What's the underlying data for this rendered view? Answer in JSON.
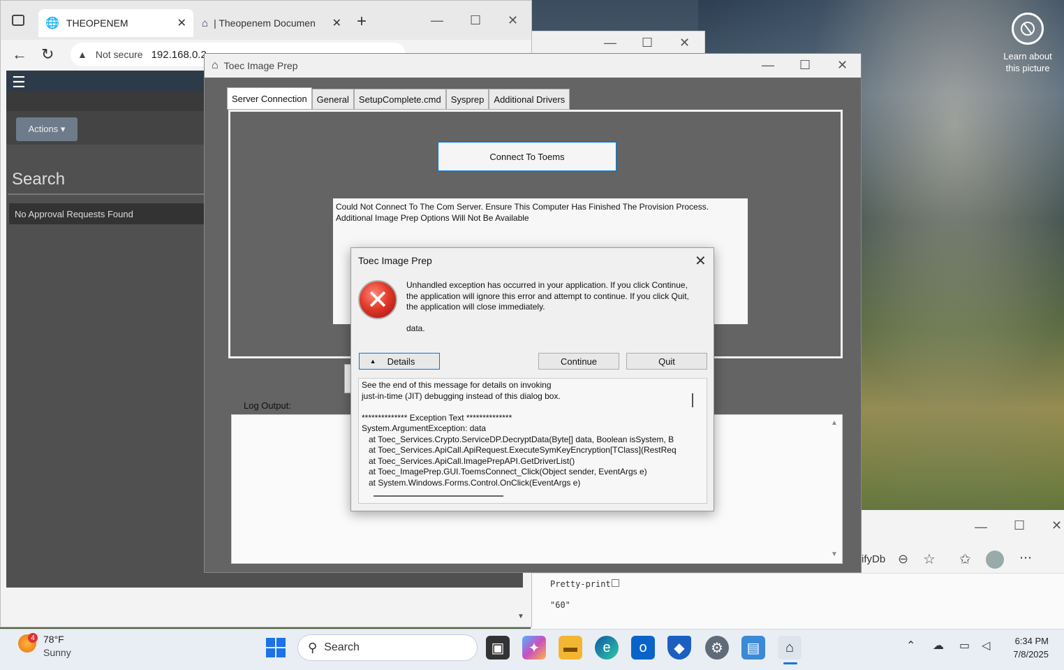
{
  "browser": {
    "tab1_label": "THEOPENEM",
    "tab2_label": "| Theopenem Documen",
    "security_label": "Not secure",
    "url": "192.168.0.2",
    "actions_label": "Actions ▾",
    "search_heading": "Search",
    "no_approval": "No Approval Requests Found"
  },
  "desktop": {
    "learn_label": "Learn about this picture"
  },
  "bg_window": {
    "partial_text": "ifyDb",
    "pretty_print": "Pretty-print",
    "json_value": "\"60\""
  },
  "toec": {
    "title": "Toec Image Prep",
    "tabs": [
      "Server Connection",
      "General",
      "SetupComplete.cmd",
      "Sysprep",
      "Additional Drivers"
    ],
    "connect_label": "Connect To Toems",
    "error_line1": "Could Not Connect To The Com Server.  Ensure This Computer Has Finished The Provision Process.",
    "error_line2": "Additional Image Prep Options Will Not Be Available",
    "log_label": "Log Output:"
  },
  "dialog": {
    "title": "Toec Image Prep",
    "message": "Unhandled exception has occurred in your application. If you click Continue, the application will ignore this error and attempt to continue. If you click Quit, the application will close immediately.",
    "data_text": "data.",
    "details_label": "Details",
    "continue_label": "Continue",
    "quit_label": "Quit",
    "details_text": "See the end of this message for details on invoking\njust-in-time (JIT) debugging instead of this dialog box.\n\n************** Exception Text **************\nSystem.ArgumentException: data\n   at Toec_Services.Crypto.ServiceDP.DecryptData(Byte[] data, Boolean isSystem, B\n   at Toec_Services.ApiCall.ApiRequest.ExecuteSymKeyEncryption[TClass](RestReq\n   at Toec_Services.ApiCall.ImagePrepAPI.GetDriverList()\n   at Toec_ImagePrep.GUI.ToemsConnect_Click(Object sender, EventArgs e)\n   at System.Windows.Forms.Control.OnClick(EventArgs e)"
  },
  "taskbar": {
    "weather_temp": "78°F",
    "weather_cond": "Sunny",
    "weather_badge": "4",
    "search_label": "Search",
    "time": "6:34 PM",
    "date": "7/8/2025"
  }
}
